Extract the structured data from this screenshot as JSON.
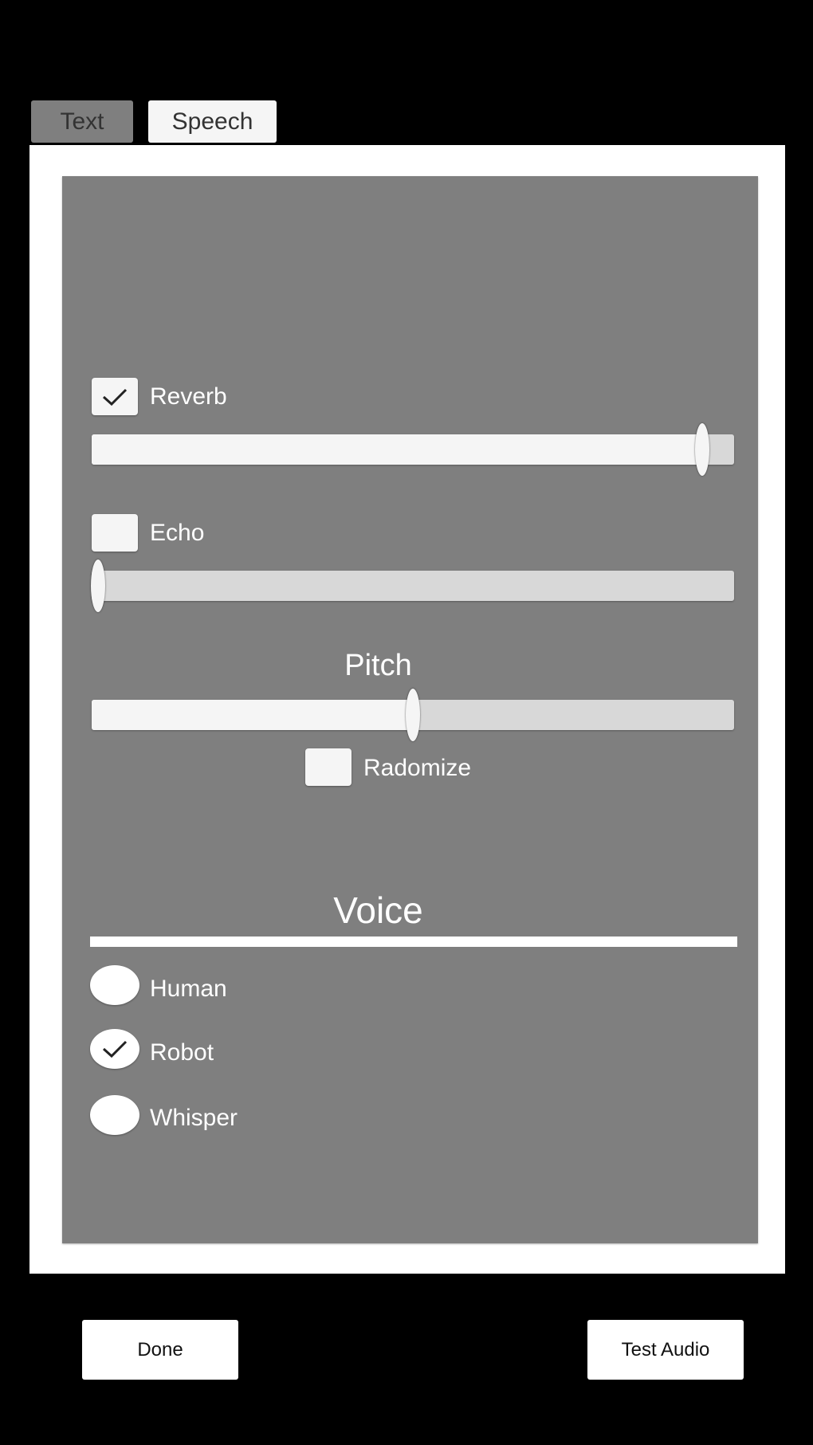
{
  "tabs": [
    {
      "label": "Text",
      "active": false
    },
    {
      "label": "Speech",
      "active": true
    }
  ],
  "effects": {
    "reverb": {
      "label": "Reverb",
      "checked": true,
      "slider_value_percent": 95
    },
    "echo": {
      "label": "Echo",
      "checked": false,
      "slider_value_percent": 1
    },
    "pitch": {
      "label": "Pitch",
      "slider_value_percent": 50,
      "randomize_label": "Radomize",
      "randomize_checked": false
    }
  },
  "voice": {
    "heading": "Voice",
    "options": [
      {
        "label": "Human",
        "selected": false
      },
      {
        "label": "Robot",
        "selected": true
      },
      {
        "label": "Whisper",
        "selected": false
      }
    ]
  },
  "buttons": {
    "done_label": "Done",
    "test_audio_label": "Test Audio"
  },
  "icons": {
    "check": "check-icon"
  }
}
